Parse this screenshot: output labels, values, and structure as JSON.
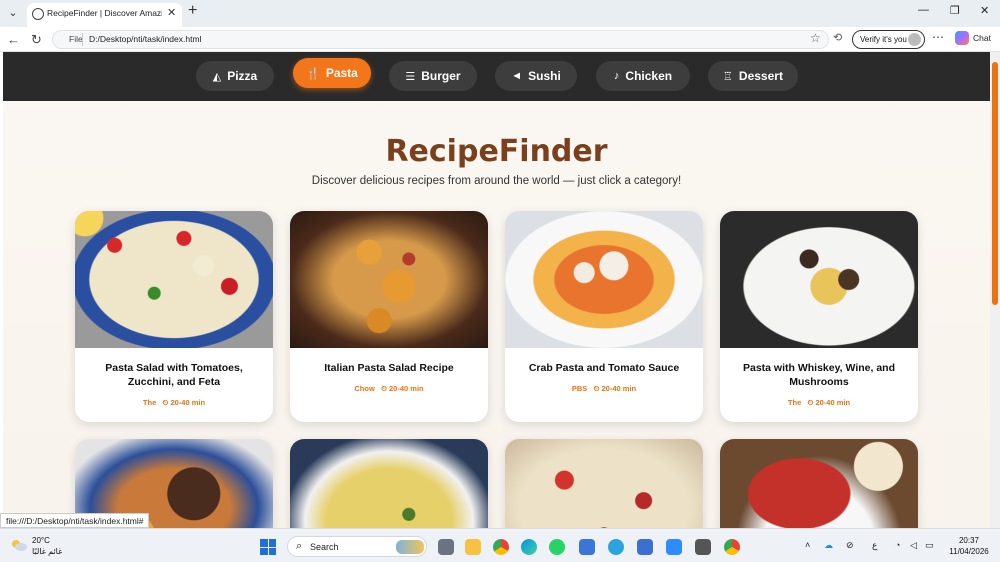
{
  "browser": {
    "tab_title": "RecipeFinder | Discover Amazing R",
    "url_scheme": "File",
    "url": "D:/Desktop/nti/task/index.html",
    "verify_label": "Verify it's you",
    "chat_label": "Chat",
    "status_url": "file:///D:/Desktop/nti/task/index.html#"
  },
  "nav": {
    "categories": [
      {
        "label": "Pizza",
        "icon": "pizza-icon",
        "glyph": "◭",
        "active": false
      },
      {
        "label": "Pasta",
        "icon": "utensils-icon",
        "glyph": "🍴",
        "active": true
      },
      {
        "label": "Burger",
        "icon": "burger-icon",
        "glyph": "☰",
        "active": false
      },
      {
        "label": "Sushi",
        "icon": "fish-icon",
        "glyph": "◄",
        "active": false
      },
      {
        "label": "Chicken",
        "icon": "drumstick-icon",
        "glyph": "♪",
        "active": false
      },
      {
        "label": "Dessert",
        "icon": "cake-icon",
        "glyph": "♖",
        "active": false
      }
    ]
  },
  "hero": {
    "title": "RecipeFinder",
    "subtitle": "Discover delicious recipes from around the world — just click a category!"
  },
  "recipes": [
    {
      "title": "Pasta Salad with Tomatoes, Zucchini, and Feta",
      "source": "The",
      "time": "20-40 min"
    },
    {
      "title": "Italian Pasta Salad Recipe",
      "source": "Chow",
      "time": "20-40 min"
    },
    {
      "title": "Crab Pasta and Tomato Sauce",
      "source": "PBS",
      "time": "20-40 min"
    },
    {
      "title": "Pasta with Whiskey, Wine, and Mushrooms",
      "source": "The",
      "time": "20-40 min"
    },
    {
      "title": "",
      "source": "",
      "time": ""
    },
    {
      "title": "",
      "source": "",
      "time": ""
    },
    {
      "title": "",
      "source": "",
      "time": ""
    },
    {
      "title": "",
      "source": "",
      "time": ""
    }
  ],
  "taskbar": {
    "temperature": "20°C",
    "location": "غائم غالبًا",
    "search_placeholder": "Search",
    "time": "20:37",
    "date": "11/04/2026",
    "lang": "ع"
  },
  "colors": {
    "accent": "#f3761b",
    "title_brown": "#7a3f1c",
    "nav_bg": "#2a2a2a"
  }
}
